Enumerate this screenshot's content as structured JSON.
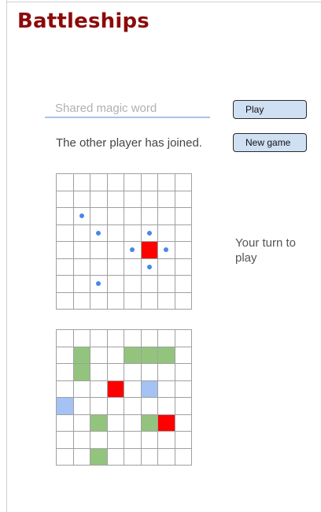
{
  "app": {
    "title": "Battleships"
  },
  "controls": {
    "magic_word_placeholder": "Shared magic word",
    "play_label": "Play",
    "new_game_label": "New game"
  },
  "status": {
    "message": "The other player has joined.",
    "turn_text": "Your turn to play"
  },
  "colors": {
    "title": "#8b0a0a",
    "hit": "#ff0000",
    "ship": "#93c47d",
    "miss_own": "#a4c2f4",
    "miss_dot": "#4a86e8",
    "button_bg": "#cfe0f3"
  },
  "boards": {
    "size": 8,
    "opponent": {
      "hits": [
        [
          4,
          5
        ]
      ],
      "misses": [
        [
          2,
          1
        ],
        [
          3,
          2
        ],
        [
          3,
          5
        ],
        [
          4,
          4
        ],
        [
          4,
          6
        ],
        [
          5,
          5
        ],
        [
          6,
          2
        ]
      ]
    },
    "own": {
      "ships": [
        [
          1,
          1
        ],
        [
          1,
          4
        ],
        [
          1,
          5
        ],
        [
          1,
          6
        ],
        [
          2,
          1
        ],
        [
          5,
          2
        ],
        [
          5,
          5
        ],
        [
          7,
          2
        ]
      ],
      "hits": [
        [
          3,
          3
        ],
        [
          5,
          6
        ]
      ],
      "misses": [
        [
          3,
          5
        ],
        [
          4,
          0
        ]
      ]
    }
  }
}
